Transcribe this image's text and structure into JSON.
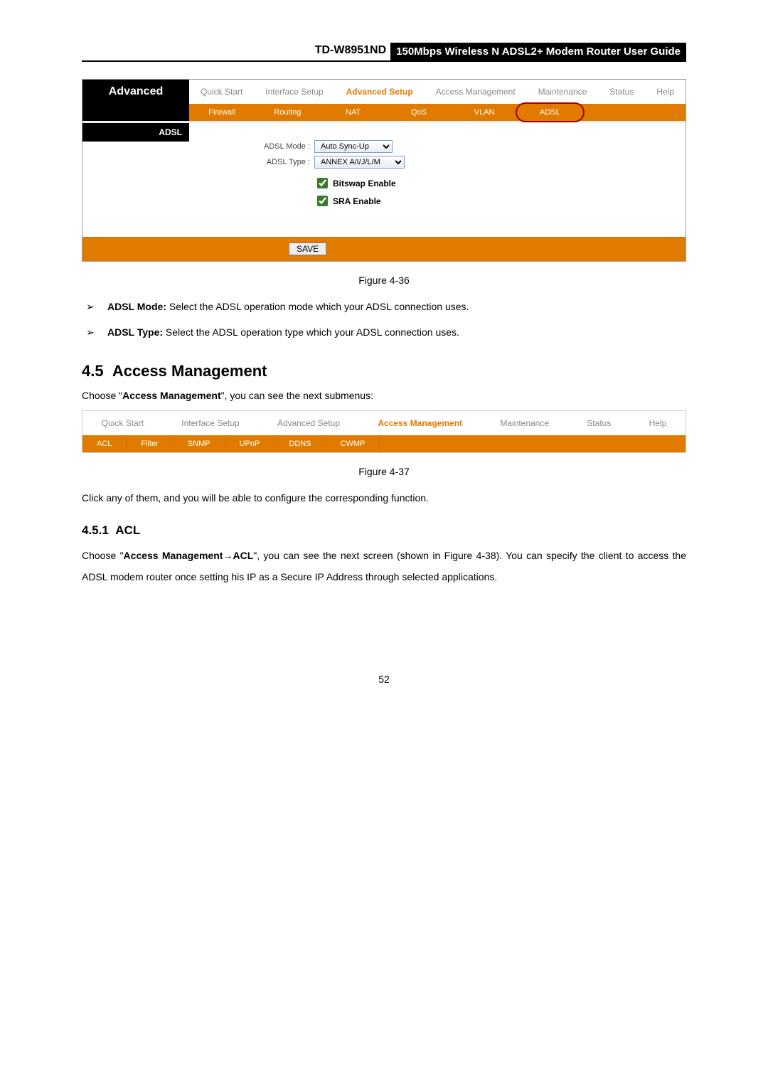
{
  "header": {
    "model": "TD-W8951ND",
    "title": "150Mbps Wireless N ADSL2+ Modem Router User Guide"
  },
  "fig1": {
    "section_label": "Advanced",
    "tabs": [
      "Quick Start",
      "Interface Setup",
      "Advanced Setup",
      "Access Management",
      "Maintenance",
      "Status",
      "Help"
    ],
    "active_tab_index": 2,
    "subtabs": [
      "Firewall",
      "Routing",
      "NAT",
      "QoS",
      "VLAN",
      "ADSL"
    ],
    "highlight_subtab_index": 5,
    "side_label": "ADSL",
    "adsl_mode_label": "ADSL Mode :",
    "adsl_mode_value": "Auto Sync-Up",
    "adsl_type_label": "ADSL Type :",
    "adsl_type_value": "ANNEX A/I/J/L/M",
    "cb1": "Bitswap Enable",
    "cb2": "SRA Enable",
    "save": "SAVE"
  },
  "caption1": "Figure 4-36",
  "bullets": [
    {
      "label": "ADSL Mode:",
      "text": " Select the ADSL operation mode which your ADSL connection uses."
    },
    {
      "label": "ADSL Type:",
      "text": " Select the ADSL operation type which your ADSL connection uses."
    }
  ],
  "sec45_num": "4.5",
  "sec45_title": "Access Management",
  "sec45_intro_pre": "Choose \"",
  "sec45_intro_bold": "Access Management",
  "sec45_intro_post": "\", you can see the next submenus:",
  "fig2": {
    "tabs": [
      "Quick Start",
      "Interface Setup",
      "Advanced Setup",
      "Access Management",
      "Maintenance",
      "Status",
      "Help"
    ],
    "active_tab_index": 3,
    "subtabs": [
      "ACL",
      "Filter",
      "SNMP",
      "UPnP",
      "DDNS",
      "CWMP"
    ]
  },
  "caption2": "Figure 4-37",
  "after_fig2": "Click any of them, and you will be able to configure the corresponding function.",
  "sec451_num": "4.5.1",
  "sec451_title": "ACL",
  "sec451_para_parts": {
    "p1": "Choose \"",
    "b1": "Access Management",
    "arrow": "→",
    "b2": "ACL",
    "p2": "\", you can see the next screen (shown in Figure 4-38). You can specify the client to access the ADSL modem router once setting his IP as a Secure IP Address through selected applications."
  },
  "page_number": "52"
}
